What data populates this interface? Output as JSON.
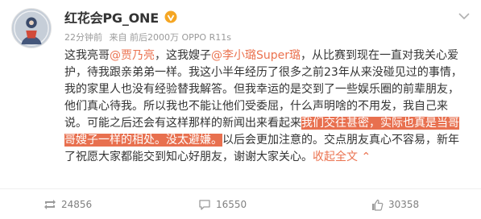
{
  "post": {
    "username": "红花会PG_ONE",
    "time": "22分钟前",
    "source": "来自 前后2000万 OPPO R11s",
    "lines": [
      [
        {
          "t": "这我亮哥"
        },
        {
          "t": "@贾乃亮",
          "c": "mention"
        },
        {
          "t": "，这我嫂子"
        },
        {
          "t": "@李小璐Super璐",
          "c": "mention"
        },
        {
          "t": "，从比赛到现在一直对我关心爱"
        }
      ],
      [
        {
          "t": "护，待我跟亲弟弟一样。我这小半年经历了很多之前23年从来没碰见过的事情，"
        }
      ],
      [
        {
          "t": "我的家里人也没有经验替我解答。但我幸运的是交到了一些娱乐圈的前辈朋友，"
        }
      ],
      [
        {
          "t": "他们真心待我。所以我也不能让他们受委屈，什么声明啥的不用发，我自己来"
        }
      ],
      [
        {
          "t": "说。可能之后还会有这样那样的新闻出来看起来"
        },
        {
          "t": "我们交往甚密，实际也真是当哥",
          "c": "hl"
        }
      ],
      [
        {
          "t": "哥嫂子一样的相处。没太避嫌。",
          "c": "hl"
        },
        {
          "t": "以后会更加注意的。交点朋友真心不容易，新年"
        }
      ],
      [
        {
          "t": "了祝愿大家都能交到知心好朋友，谢谢大家关心。"
        },
        {
          "t": "收起全文",
          "c": "collapse"
        },
        {
          "t": " ⌃",
          "c": "collapse"
        }
      ]
    ]
  },
  "actions": {
    "repost_count": "24856",
    "comment_count": "16550",
    "like_count": "30358"
  },
  "colors": {
    "accent": "#eb7350",
    "highlight": "#e8704f",
    "verify": "#f5a623"
  }
}
